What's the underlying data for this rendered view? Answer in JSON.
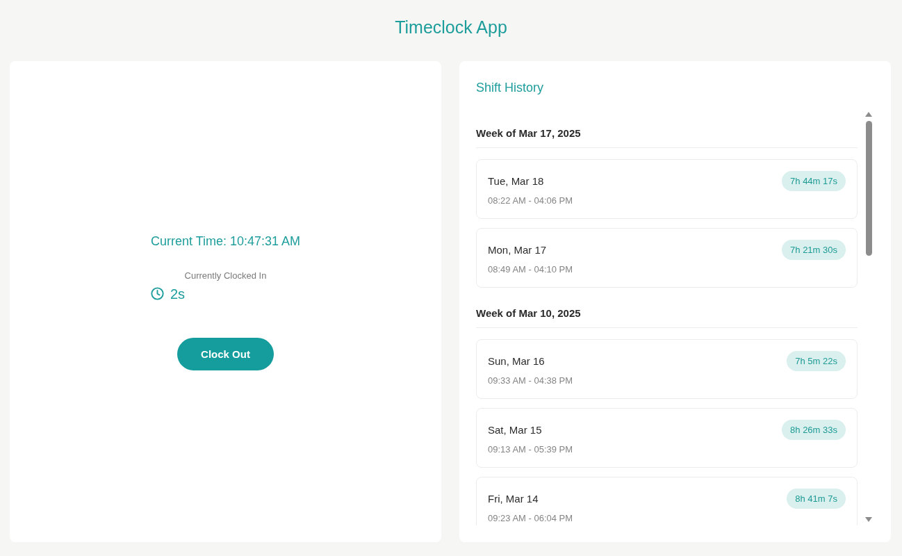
{
  "app": {
    "title": "Timeclock App"
  },
  "clock": {
    "current_time": "Current Time: 10:47:31 AM",
    "status": "Currently Clocked In",
    "elapsed": "2s",
    "button": "Clock Out"
  },
  "history": {
    "title": "Shift History",
    "weeks": [
      {
        "label": "Week of Mar 17, 2025",
        "shifts": [
          {
            "day": "Tue, Mar 18",
            "range": "08:22 AM - 04:06 PM",
            "duration": "7h 44m 17s"
          },
          {
            "day": "Mon, Mar 17",
            "range": "08:49 AM - 04:10 PM",
            "duration": "7h 21m 30s"
          }
        ]
      },
      {
        "label": "Week of Mar 10, 2025",
        "shifts": [
          {
            "day": "Sun, Mar 16",
            "range": "09:33 AM - 04:38 PM",
            "duration": "7h 5m 22s"
          },
          {
            "day": "Sat, Mar 15",
            "range": "09:13 AM - 05:39 PM",
            "duration": "8h 26m 33s"
          },
          {
            "day": "Fri, Mar 14",
            "range": "09:23 AM - 06:04 PM",
            "duration": "8h 41m 7s"
          }
        ]
      }
    ]
  }
}
